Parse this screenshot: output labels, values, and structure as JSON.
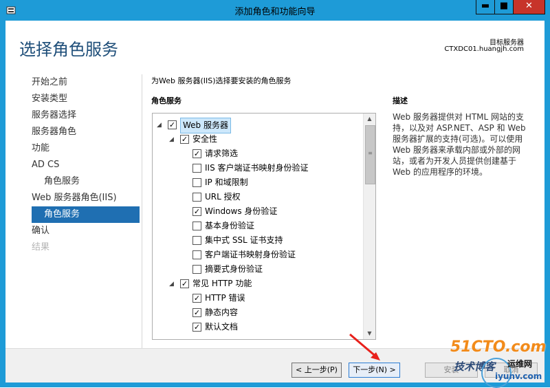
{
  "window": {
    "title": "添加角色和功能向导",
    "minimize": "▬",
    "maximize": "■",
    "close": "✕"
  },
  "header": {
    "page_title": "选择角色服务",
    "dest_label": "目标服务器",
    "dest_server": "CTXDC01.huangjh.com"
  },
  "nav": [
    {
      "label": "开始之前",
      "state": "normal"
    },
    {
      "label": "安装类型",
      "state": "normal"
    },
    {
      "label": "服务器选择",
      "state": "normal"
    },
    {
      "label": "服务器角色",
      "state": "normal"
    },
    {
      "label": "功能",
      "state": "normal"
    },
    {
      "label": "AD CS",
      "state": "normal"
    },
    {
      "label": "角色服务",
      "state": "sub"
    },
    {
      "label": "Web 服务器角色(IIS)",
      "state": "normal"
    },
    {
      "label": "角色服务",
      "state": "active"
    },
    {
      "label": "确认",
      "state": "normal"
    },
    {
      "label": "结果",
      "state": "disabled"
    }
  ],
  "main": {
    "intro": "为Web 服务器(IIS)选择要安装的角色服务",
    "roles_label": "角色服务",
    "desc_label": "描述",
    "description": "Web 服务器提供对 HTML 网站的支持，以及对 ASP.NET、ASP 和 Web 服务器扩展的支持(可选)。可以使用 Web 服务器来承载内部或外部的网站，或者为开发人员提供创建基于 Web 的应用程序的环境。"
  },
  "tree": [
    {
      "label": "Web 服务器",
      "level": 0,
      "checked": true,
      "expander": true,
      "selected": true
    },
    {
      "label": "安全性",
      "level": 1,
      "checked": true,
      "expander": true
    },
    {
      "label": "请求筛选",
      "level": 2,
      "checked": true
    },
    {
      "label": "IIS 客户端证书映射身份验证",
      "level": 2,
      "checked": false
    },
    {
      "label": "IP 和域限制",
      "level": 2,
      "checked": false
    },
    {
      "label": "URL 授权",
      "level": 2,
      "checked": false
    },
    {
      "label": "Windows 身份验证",
      "level": 2,
      "checked": true
    },
    {
      "label": "基本身份验证",
      "level": 2,
      "checked": false
    },
    {
      "label": "集中式 SSL 证书支持",
      "level": 2,
      "checked": false
    },
    {
      "label": "客户端证书映射身份验证",
      "level": 2,
      "checked": false
    },
    {
      "label": "摘要式身份验证",
      "level": 2,
      "checked": false
    },
    {
      "label": "常见 HTTP 功能",
      "level": 1,
      "checked": true,
      "expander": true
    },
    {
      "label": "HTTP 错误",
      "level": 2,
      "checked": true
    },
    {
      "label": "静态内容",
      "level": 2,
      "checked": true
    },
    {
      "label": "默认文档",
      "level": 2,
      "checked": true
    }
  ],
  "buttons": {
    "prev": "< 上一步(P)",
    "next": "下一步(N) >",
    "install": "安装",
    "cancel": "取消"
  },
  "watermark": {
    "line1": "51CTO.com",
    "line2": "技术博客",
    "site1": "运维网",
    "site2": "iyunv.com"
  },
  "colors": {
    "accent": "#1e9bd7",
    "nav_active": "#1f6fb2",
    "close": "#c7342a",
    "heading": "#1e4e79"
  }
}
